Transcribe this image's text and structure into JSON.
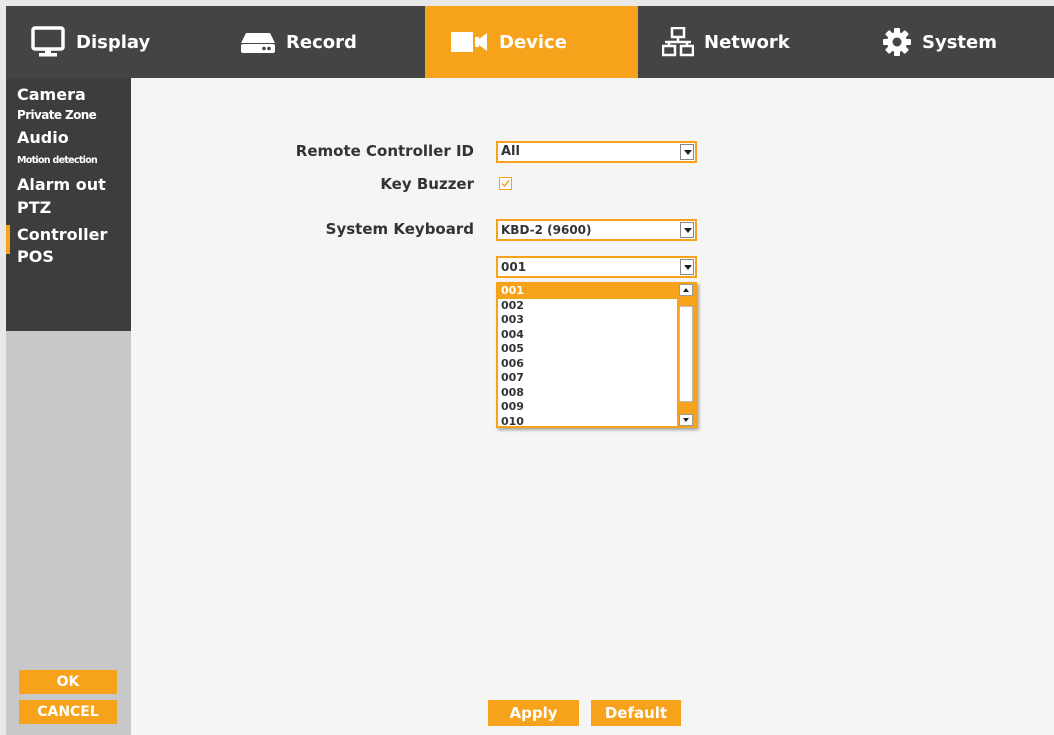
{
  "colors": {
    "accent": "#f7a21b",
    "topbar": "#444444",
    "sidebar_menu": "#3d3d3d",
    "sidebar": "#c8c8c8",
    "content": "#f5f5f5"
  },
  "tabs": [
    {
      "label": "Display",
      "icon": "monitor-icon"
    },
    {
      "label": "Record",
      "icon": "recorder-icon"
    },
    {
      "label": "Device",
      "icon": "camera-icon",
      "active": true
    },
    {
      "label": "Network",
      "icon": "network-icon"
    },
    {
      "label": "System",
      "icon": "gear-icon"
    }
  ],
  "sidebar": {
    "items": [
      {
        "label": "Camera"
      },
      {
        "label": "Private Zone"
      },
      {
        "label": "Audio"
      },
      {
        "label": "Motion detection"
      },
      {
        "label": "Alarm out"
      },
      {
        "label": "PTZ"
      },
      {
        "label": "Controller",
        "active": true
      },
      {
        "label": "POS"
      }
    ],
    "ok_label": "OK",
    "cancel_label": "CANCEL"
  },
  "form": {
    "remote_controller_id": {
      "label": "Remote Controller ID",
      "value": "All"
    },
    "key_buzzer": {
      "label": "Key Buzzer",
      "checked": true
    },
    "system_keyboard": {
      "label": "System Keyboard",
      "value": "KBD-2 (9600)"
    },
    "keyboard_id": {
      "value": "001"
    }
  },
  "dropdown": {
    "options": [
      "001",
      "002",
      "003",
      "004",
      "005",
      "006",
      "007",
      "008",
      "009",
      "010"
    ],
    "selected": "001"
  },
  "buttons": {
    "apply": "Apply",
    "default": "Default"
  }
}
